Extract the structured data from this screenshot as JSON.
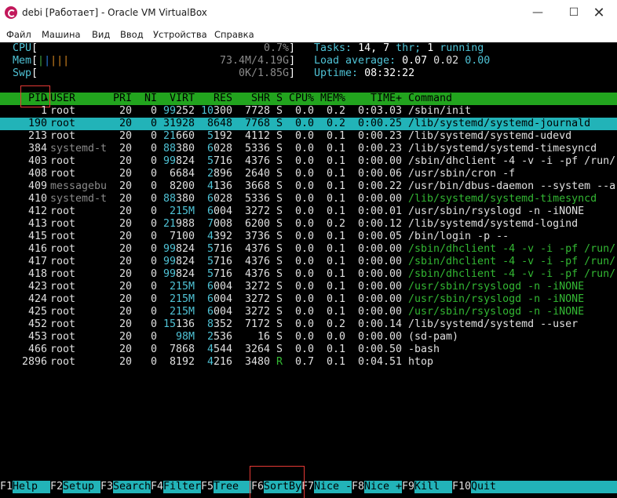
{
  "window": {
    "title": "debi [Работает] - Oracle VM VirtualBox",
    "controls": [
      "minimize-icon",
      "maximize-icon",
      "close-icon"
    ]
  },
  "menu": [
    "Файл",
    "Машина",
    "Вид",
    "Ввод",
    "Устройства",
    "Справка"
  ],
  "meters": {
    "cpu_label": "CPU",
    "cpu_value": "0.7%",
    "mem_label": "Mem",
    "mem_value": "73.4M/4.19G",
    "swp_label": "Swp",
    "swp_value": "0K/1.85G"
  },
  "summary": {
    "tasks_label": "Tasks:",
    "tasks": "14,",
    "threads": "7",
    "thr_label": "thr;",
    "running": "1",
    "running_label": "running",
    "load_label": "Load average:",
    "load1": "0.07",
    "load5": "0.02",
    "load15": "0.00",
    "uptime_label": "Uptime:",
    "uptime": "08:32:22"
  },
  "columns": [
    "PID",
    "USER",
    "PRI",
    "NI",
    "VIRT",
    "RES",
    "SHR",
    "S",
    "CPU%",
    "MEM%",
    "TIME+",
    "Command"
  ],
  "sort_indicator": "▲",
  "processes": [
    {
      "pid": "1",
      "user": "root",
      "pri": "20",
      "ni": "0",
      "virt": "99252",
      "res": "10300",
      "shr": "7728",
      "s": "S",
      "cpu": "0.0",
      "mem": "0.2",
      "time": "0:03.03",
      "cmd": "/sbin/init"
    },
    {
      "pid": "190",
      "user": "root",
      "pri": "20",
      "ni": "0",
      "virt": "31928",
      "res": "8648",
      "shr": "7768",
      "s": "S",
      "cpu": "0.0",
      "mem": "0.2",
      "time": "0:00.25",
      "cmd": "/lib/systemd/systemd-journald"
    },
    {
      "pid": "213",
      "user": "root",
      "pri": "20",
      "ni": "0",
      "virt": "21660",
      "res": "5192",
      "shr": "4112",
      "s": "S",
      "cpu": "0.0",
      "mem": "0.1",
      "time": "0:00.23",
      "cmd": "/lib/systemd/systemd-udevd"
    },
    {
      "pid": "384",
      "user": "systemd-t",
      "pri": "20",
      "ni": "0",
      "virt": "88380",
      "res": "6028",
      "shr": "5336",
      "s": "S",
      "cpu": "0.0",
      "mem": "0.1",
      "time": "0:00.23",
      "cmd": "/lib/systemd/systemd-timesyncd"
    },
    {
      "pid": "403",
      "user": "root",
      "pri": "20",
      "ni": "0",
      "virt": "99824",
      "res": "5716",
      "shr": "4376",
      "s": "S",
      "cpu": "0.0",
      "mem": "0.1",
      "time": "0:00.00",
      "cmd": "/sbin/dhclient -4 -v -i -pf /run/"
    },
    {
      "pid": "408",
      "user": "root",
      "pri": "20",
      "ni": "0",
      "virt": "6684",
      "res": "2896",
      "shr": "2640",
      "s": "S",
      "cpu": "0.0",
      "mem": "0.1",
      "time": "0:00.06",
      "cmd": "/usr/sbin/cron -f"
    },
    {
      "pid": "409",
      "user": "messagebu",
      "pri": "20",
      "ni": "0",
      "virt": "8200",
      "res": "4136",
      "shr": "3668",
      "s": "S",
      "cpu": "0.0",
      "mem": "0.1",
      "time": "0:00.22",
      "cmd": "/usr/bin/dbus-daemon --system --a"
    },
    {
      "pid": "410",
      "user": "systemd-t",
      "pri": "20",
      "ni": "0",
      "virt": "88380",
      "res": "6028",
      "shr": "5336",
      "s": "S",
      "cpu": "0.0",
      "mem": "0.1",
      "time": "0:00.00",
      "cmd": "/lib/systemd/systemd-timesyncd"
    },
    {
      "pid": "412",
      "user": "root",
      "pri": "20",
      "ni": "0",
      "virt": "215M",
      "res": "6004",
      "shr": "3272",
      "s": "S",
      "cpu": "0.0",
      "mem": "0.1",
      "time": "0:00.01",
      "cmd": "/usr/sbin/rsyslogd -n -iNONE"
    },
    {
      "pid": "413",
      "user": "root",
      "pri": "20",
      "ni": "0",
      "virt": "21988",
      "res": "7008",
      "shr": "6200",
      "s": "S",
      "cpu": "0.0",
      "mem": "0.2",
      "time": "0:00.12",
      "cmd": "/lib/systemd/systemd-logind"
    },
    {
      "pid": "415",
      "user": "root",
      "pri": "20",
      "ni": "0",
      "virt": "7100",
      "res": "4392",
      "shr": "3736",
      "s": "S",
      "cpu": "0.0",
      "mem": "0.1",
      "time": "0:00.05",
      "cmd": "/bin/login -p --"
    },
    {
      "pid": "416",
      "user": "root",
      "pri": "20",
      "ni": "0",
      "virt": "99824",
      "res": "5716",
      "shr": "4376",
      "s": "S",
      "cpu": "0.0",
      "mem": "0.1",
      "time": "0:00.00",
      "cmd": "/sbin/dhclient -4 -v -i -pf /run/"
    },
    {
      "pid": "417",
      "user": "root",
      "pri": "20",
      "ni": "0",
      "virt": "99824",
      "res": "5716",
      "shr": "4376",
      "s": "S",
      "cpu": "0.0",
      "mem": "0.1",
      "time": "0:00.00",
      "cmd": "/sbin/dhclient -4 -v -i -pf /run/"
    },
    {
      "pid": "418",
      "user": "root",
      "pri": "20",
      "ni": "0",
      "virt": "99824",
      "res": "5716",
      "shr": "4376",
      "s": "S",
      "cpu": "0.0",
      "mem": "0.1",
      "time": "0:00.00",
      "cmd": "/sbin/dhclient -4 -v -i -pf /run/"
    },
    {
      "pid": "423",
      "user": "root",
      "pri": "20",
      "ni": "0",
      "virt": "215M",
      "res": "6004",
      "shr": "3272",
      "s": "S",
      "cpu": "0.0",
      "mem": "0.1",
      "time": "0:00.00",
      "cmd": "/usr/sbin/rsyslogd -n -iNONE"
    },
    {
      "pid": "424",
      "user": "root",
      "pri": "20",
      "ni": "0",
      "virt": "215M",
      "res": "6004",
      "shr": "3272",
      "s": "S",
      "cpu": "0.0",
      "mem": "0.1",
      "time": "0:00.00",
      "cmd": "/usr/sbin/rsyslogd -n -iNONE"
    },
    {
      "pid": "425",
      "user": "root",
      "pri": "20",
      "ni": "0",
      "virt": "215M",
      "res": "6004",
      "shr": "3272",
      "s": "S",
      "cpu": "0.0",
      "mem": "0.1",
      "time": "0:00.00",
      "cmd": "/usr/sbin/rsyslogd -n -iNONE"
    },
    {
      "pid": "452",
      "user": "root",
      "pri": "20",
      "ni": "0",
      "virt": "15136",
      "res": "8352",
      "shr": "7172",
      "s": "S",
      "cpu": "0.0",
      "mem": "0.2",
      "time": "0:00.14",
      "cmd": "/lib/systemd/systemd --user"
    },
    {
      "pid": "453",
      "user": "root",
      "pri": "20",
      "ni": "0",
      "virt": "98M",
      "res": "2536",
      "shr": "16",
      "s": "S",
      "cpu": "0.0",
      "mem": "0.0",
      "time": "0:00.00",
      "cmd": "(sd-pam)"
    },
    {
      "pid": "466",
      "user": "root",
      "pri": "20",
      "ni": "0",
      "virt": "7868",
      "res": "4544",
      "shr": "3264",
      "s": "S",
      "cpu": "0.0",
      "mem": "0.1",
      "time": "0:00.50",
      "cmd": "-bash"
    },
    {
      "pid": "2896",
      "user": "root",
      "pri": "20",
      "ni": "0",
      "virt": "8192",
      "res": "4216",
      "shr": "3480",
      "s": "R",
      "cpu": "0.7",
      "mem": "0.1",
      "time": "0:04.51",
      "cmd": "htop"
    }
  ],
  "fkeys": [
    {
      "key": "F1",
      "label": "Help  "
    },
    {
      "key": "F2",
      "label": "Setup "
    },
    {
      "key": "F3",
      "label": "Search"
    },
    {
      "key": "F4",
      "label": "Filter"
    },
    {
      "key": "F5",
      "label": "Tree  "
    },
    {
      "key": "F6",
      "label": "SortBy"
    },
    {
      "key": "F7",
      "label": "Nice -"
    },
    {
      "key": "F8",
      "label": "Nice +"
    },
    {
      "key": "F9",
      "label": "Kill  "
    },
    {
      "key": "F10",
      "label": "Quit"
    }
  ]
}
